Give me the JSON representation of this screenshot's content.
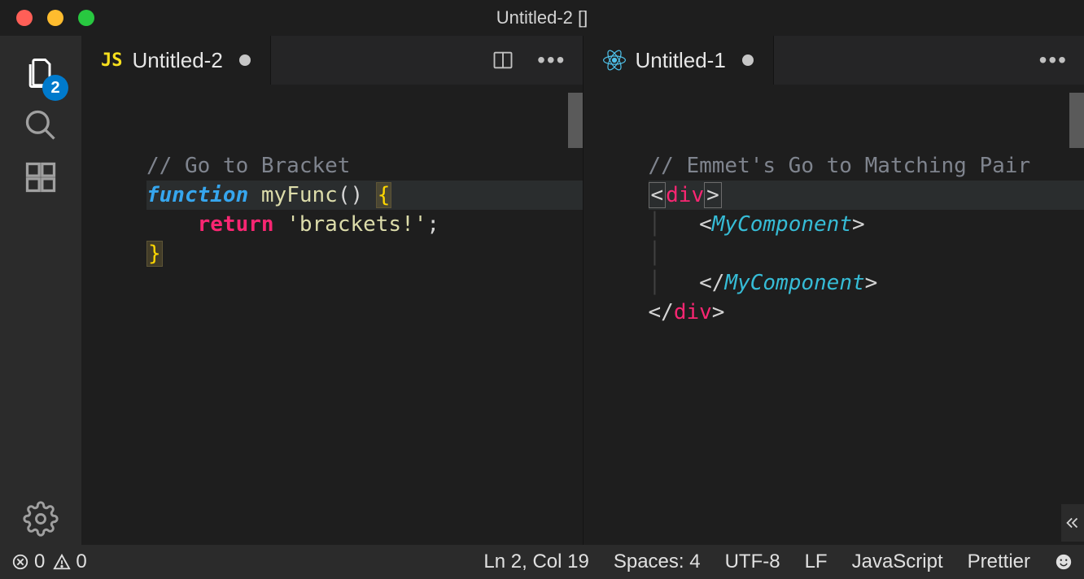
{
  "window": {
    "title": "Untitled-2 []"
  },
  "activitybar": {
    "badge": "2"
  },
  "group1": {
    "tab": {
      "icon_label": "JS",
      "label": "Untitled-2"
    },
    "code": {
      "comment": "// Go to Bracket",
      "fn_keyword": "function",
      "fn_name": "myFunc",
      "parens": "()",
      "brace_open": "{",
      "return_kw": "return",
      "string": "'brackets!'",
      "semicolon": ";",
      "brace_close": "}"
    }
  },
  "group2": {
    "tab": {
      "label": "Untitled-1"
    },
    "code": {
      "comment": "// Emmet's Go to Matching Pair",
      "lt": "<",
      "gt": ">",
      "lt_slash": "</",
      "div": "div",
      "component": "MyComponent"
    }
  },
  "statusbar": {
    "errors": "0",
    "warnings": "0",
    "cursor": "Ln 2, Col 19",
    "spaces": "Spaces: 4",
    "encoding": "UTF-8",
    "eol": "LF",
    "language": "JavaScript",
    "formatter": "Prettier"
  }
}
